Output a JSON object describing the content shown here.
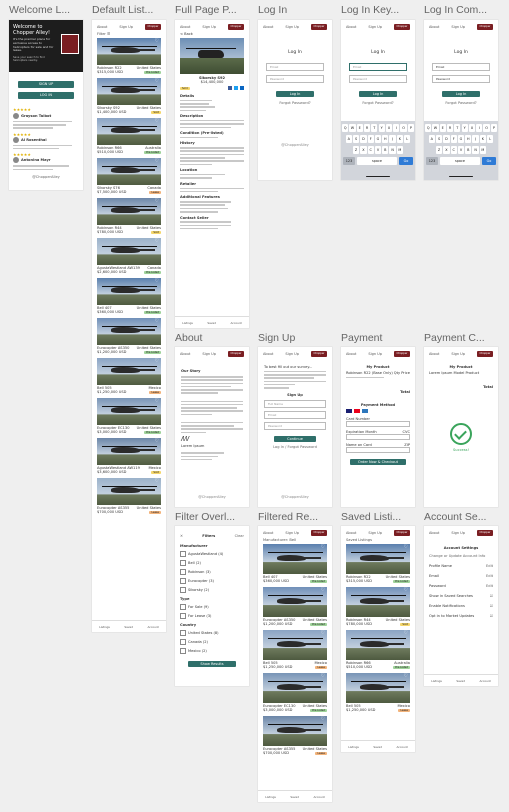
{
  "frames": {
    "welcome": "Welcome L...",
    "default_list": "Default List...",
    "full_page": "Full Page P...",
    "login": "Log In",
    "login_kb": "Log In Key...",
    "login_complete": "Log In Com...",
    "about": "About",
    "signup": "Sign Up",
    "payment": "Payment",
    "payment_complete": "Payment C...",
    "filter": "Filter Overl...",
    "filtered": "Filtered Re...",
    "saved": "Saved Listi...",
    "account": "Account Se..."
  },
  "nav": {
    "about": "About",
    "signup": "Sign Up",
    "login": "Log In",
    "logo": "Chopper Alley"
  },
  "tabs": {
    "listings": "Listings",
    "saved": "Saved",
    "account": "Account"
  },
  "welcome": {
    "title": "Welcome to Chopper Alley!",
    "body": "It's the premier place for exclusive access to helicopters for sale and for lease.",
    "sub": "Save your search to find helicopters nearby.",
    "signup": "SIGN UP",
    "login": "LOG IN",
    "review1_name": "Grayson Talbot",
    "review1_meta": "2 months",
    "review2_name": "Al Rosenthal",
    "review2_meta": "1 month",
    "review3_name": "Antonina Mayr",
    "footer": "@ChopperAlley"
  },
  "default_list": {
    "filter_label": "Filter ☰",
    "items": [
      {
        "model": "Robinson R22",
        "loc": "United States",
        "price": "$315,000 USD",
        "tag": "Pre-Listed",
        "tagcolor": "#9fd39a"
      },
      {
        "model": "Sikorsky S92",
        "loc": "United States",
        "price": "$1,400,000 USD",
        "tag": "Sold",
        "tagcolor": "#f5d66b"
      },
      {
        "model": "Robinson R66",
        "loc": "Australia",
        "price": "$510,000 USD",
        "tag": "Pre-Listed",
        "tagcolor": "#9fd39a"
      },
      {
        "model": "Sikorsky S76",
        "loc": "Canada",
        "price": "$7,500,000 USD",
        "tag": "Lease",
        "tagcolor": "#f2b37a"
      },
      {
        "model": "Robinson R44",
        "loc": "United States",
        "price": "$780,000 USD",
        "tag": "Sold",
        "tagcolor": "#f5d66b"
      },
      {
        "model": "AgustaWestland AW139",
        "loc": "Canada",
        "price": "$2,600,000 USD",
        "tag": "Pre-Listed",
        "tagcolor": "#9fd39a"
      },
      {
        "model": "Bell 407",
        "loc": "United States",
        "price": "$360,000 USD",
        "tag": "Pre-Listed",
        "tagcolor": "#9fd39a"
      },
      {
        "model": "Eurocopter AS350",
        "loc": "United States",
        "price": "$1,200,000 USD",
        "tag": "Pre-Listed",
        "tagcolor": "#9fd39a"
      },
      {
        "model": "Bell 505",
        "loc": "Mexico",
        "price": "$1,250,000 USD",
        "tag": "Lease",
        "tagcolor": "#f2b37a"
      },
      {
        "model": "Eurocopter EC130",
        "loc": "United States",
        "price": "$3,000,000 USD",
        "tag": "Pre-Listed",
        "tagcolor": "#9fd39a"
      },
      {
        "model": "AgustaWestland AW119",
        "loc": "Mexico",
        "price": "$3,600,000 USD",
        "tag": "Sold",
        "tagcolor": "#f5d66b"
      },
      {
        "model": "Eurocopter AS355",
        "loc": "United States",
        "price": "$700,000 USD",
        "tag": "Lease",
        "tagcolor": "#f2b37a"
      }
    ]
  },
  "full_page": {
    "back": "< Back",
    "title": "Sikorsky S92",
    "price": "$14,400,000",
    "details": "Details",
    "description": "Description",
    "condition": "Condition (Pre-listed)",
    "history": "History",
    "location": "Location",
    "retailer": "Retailer",
    "additional": "Additional Features",
    "contact": "Contact Seller"
  },
  "login": {
    "title": "Log In",
    "email": "Email",
    "password": "Password",
    "button": "Log In",
    "forgot": "Forgot Password?"
  },
  "keyboard": {
    "row1": [
      "Q",
      "W",
      "E",
      "R",
      "T",
      "Y",
      "U",
      "I",
      "O",
      "P"
    ],
    "row2": [
      "A",
      "S",
      "D",
      "F",
      "G",
      "H",
      "J",
      "K",
      "L"
    ],
    "row3": [
      "Z",
      "X",
      "C",
      "V",
      "B",
      "N",
      "M"
    ],
    "num": "123",
    "space": "space",
    "go": "Go"
  },
  "about": {
    "title": "Our Story",
    "signature": "Lorem Ipsum"
  },
  "signup": {
    "intro": "To best fill out our survey...",
    "title": "Sign Up",
    "name": "Full Name",
    "email": "Email",
    "password": "Password",
    "button": "Continue",
    "login_link": "Log In / Forgot Password"
  },
  "payment": {
    "title": "My Product",
    "product": "Robinson R22 (Base Only)",
    "qty": "Qty",
    "price": "Price",
    "total": "Total",
    "method": "Payment Method",
    "card": "Card Number",
    "cvc": "CVC",
    "exp": "Expiration Month",
    "year": "Exp. Year",
    "name": "Name on Card",
    "zip": "ZIP",
    "button": "Order Now & Checkout"
  },
  "payment_complete": {
    "title": "My Product",
    "product": "Lorem Ipsum Model Product",
    "total": "Total",
    "status": "Success!"
  },
  "filter": {
    "title": "Filters",
    "close": "Clear",
    "manufacturer": "Manufacturer",
    "makers": [
      "AgustaWestland (4)",
      "Bell (2)",
      "Robinson (3)",
      "Eurocopter (3)",
      "Sikorsky (2)"
    ],
    "type": "Type",
    "types": [
      "For Sale (9)",
      "For Lease (3)"
    ],
    "country": "Country",
    "countries": [
      "United States (8)",
      "Canada (2)",
      "Mexico (2)"
    ],
    "button": "Show Results"
  },
  "filtered": {
    "label": "Manufacturer: Bell",
    "items": [
      {
        "model": "Bell 407",
        "loc": "United States",
        "price": "$360,000 USD",
        "tag": "Pre-Listed",
        "tagcolor": "#9fd39a"
      },
      {
        "model": "Eurocopter AS350",
        "loc": "United States",
        "price": "$1,200,000 USD",
        "tag": "Pre-Listed",
        "tagcolor": "#9fd39a"
      },
      {
        "model": "Bell 505",
        "loc": "Mexico",
        "price": "$1,250,000 USD",
        "tag": "Lease",
        "tagcolor": "#f2b37a"
      },
      {
        "model": "Eurocopter EC130",
        "loc": "United States",
        "price": "$3,000,000 USD",
        "tag": "Pre-Listed",
        "tagcolor": "#9fd39a"
      },
      {
        "model": "Eurocopter AS355",
        "loc": "United States",
        "price": "$700,000 USD",
        "tag": "Lease",
        "tagcolor": "#f2b37a"
      }
    ]
  },
  "saved": {
    "label": "Saved Listings",
    "items": [
      {
        "model": "Robinson R22",
        "loc": "United States",
        "price": "$315,000 USD",
        "tag": "Pre-Listed",
        "tagcolor": "#9fd39a"
      },
      {
        "model": "Robinson R44",
        "loc": "United States",
        "price": "$780,000 USD",
        "tag": "Sold",
        "tagcolor": "#f5d66b"
      },
      {
        "model": "Robinson R66",
        "loc": "Australia",
        "price": "$510,000 USD",
        "tag": "Pre-Listed",
        "tagcolor": "#9fd39a"
      },
      {
        "model": "Bell 505",
        "loc": "Mexico",
        "price": "$1,250,000 USD",
        "tag": "Lease",
        "tagcolor": "#f2b37a"
      }
    ]
  },
  "account": {
    "title": "Account Settings",
    "sub": "Change or Update Account Info",
    "rows": [
      "Profile Name",
      "Email",
      "Password",
      "Show in Saved Searches",
      "Enable Notifications",
      "Opt in to Market Updates"
    ]
  }
}
